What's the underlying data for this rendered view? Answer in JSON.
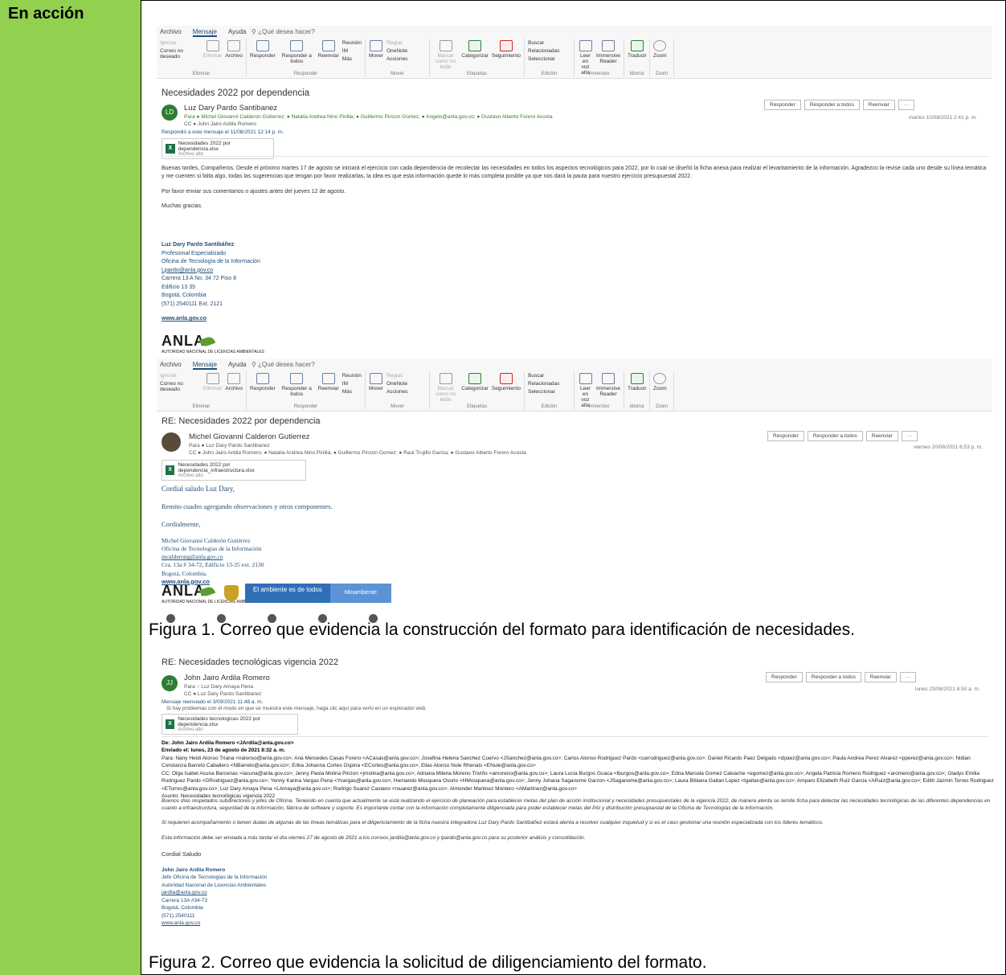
{
  "side_label": "En acción",
  "ribbon": {
    "menu": [
      "Archivo",
      "Mensaje",
      "Ayuda"
    ],
    "tell_me": "¿Qué desea hacer?",
    "groups": [
      {
        "label": "Eliminar",
        "buttons": [
          "Ignorar",
          "Correo no deseado",
          "Eliminar",
          "Archivo"
        ]
      },
      {
        "label": "Responder",
        "buttons": [
          "Responder",
          "Responder a todos",
          "Reenviar",
          "Reunión",
          "IM",
          "Más"
        ]
      },
      {
        "label": "Mover",
        "buttons": [
          "Mover",
          "Reglas",
          "OneNote",
          "Acciones"
        ]
      },
      {
        "label": "Etiquetas",
        "buttons": [
          "Marcar como no leído",
          "Categorizar",
          "Seguimiento"
        ]
      },
      {
        "label": "Edición",
        "buttons": [
          "Buscar",
          "Relacionadas",
          "Seleccionar"
        ]
      },
      {
        "label": "Inmersivo",
        "buttons": [
          "Leer en voz alta",
          "Immersive Reader"
        ]
      },
      {
        "label": "Idioma",
        "buttons": [
          "Traducir"
        ]
      },
      {
        "label": "Zoom",
        "buttons": [
          "Zoom"
        ]
      }
    ]
  },
  "actions": {
    "reply": "Responder",
    "reply_all": "Responder a todos",
    "forward": "Reenviar",
    "more": "···"
  },
  "email1": {
    "subject": "Necesidades 2022 por dependencia",
    "initials": "LD",
    "sender": "Luz Dary Pardo Santibanez",
    "to": "Para  ● Michel Giovanni Calderon Gutierrez; ● Natalia Andrea Nino Pinilla; ● Guillermo Pinzon Gomez; ● Angelo@anla.gov.co; ● Gustavo Alberto Forero Acosta",
    "cc": "CC  ● John Jairo Ardila Romero",
    "info": "Respondió a este mensaje el 11/08/2021 12:14 p. m.",
    "date": "martes 10/08/2021 2:41 p. m.",
    "attachment": "Necesidades 2022 por dependencia.xlsx",
    "attachment_size": "Archivo alto",
    "body": [
      "Buenas tardes, Compañeros. Desde el próximo martes 17 de agosto se iniciará el ejercicio con cada dependencia de recolectar las necesidades en todos los aspectos tecnológicos para 2022, por lo cual se diseñó la ficha anexa para realizar el levantamiento de la información. Agradezco la revise cada uno desde su línea temática y me cuenten si falta algo, todas las sugerencias que tengan por favor realizarlas, la idea es que esta información quede lo más completa posible ya que nos dará la pauta para nuestro ejercicio presupuestal 2022.",
      "Por favor enviar sus comentarios o ajustes antes del jueves 12 de agosto.",
      "Muchas gracias."
    ],
    "signature": {
      "name": "Luz Dary Pardo Santibáñez",
      "lines": [
        "Profesional Especializado",
        "Oficina de Tecnología de la Información",
        "Lpardo@anla.gov.co",
        "Carrera 13 A No. 34 72 Piso 8",
        "Edificio 13 35",
        "Bogotá, Colombia",
        "(571) 2540111 Ext. 2121"
      ],
      "web": "www.anla.gov.co"
    }
  },
  "logo": {
    "text": "ANLA",
    "subtitle": "AUTORIDAD NACIONAL DE LICENCIAS AMBIENTALES"
  },
  "email2": {
    "subject": "RE: Necesidades 2022 por dependencia",
    "sender": "Michel Giovanni Calderon Gutierrez",
    "to": "Para  ● Luz Dary Pardo Santibanez",
    "cc": "CC  ● John Jairo Ardila Romero; ● Natalia Andrea Nino Pinilla; ● Guillermo Pinzon Gomez; ● Raul Trujillo Garcia; ● Gustavo Alberto Forero Acosta",
    "date": "viernes 20/08/2021 6:53 p. m.",
    "attachment": "Necesidades 2022 por dependencia_infraestructura.xlsx",
    "attachment_size": "Archivo alto",
    "greeting": "Cordial saludo Luz Dary,",
    "body": "Remito cuadro agregando observaciones y otros componentes.",
    "closing": "Cordialmente,",
    "signature": [
      "Michel Giovanni Calderón Gutiérrez",
      "Oficina de Tecnologías de la Información",
      "mcalderong@anla.gov.co",
      "Cra. 13a # 34-72, Edificio 13-35 ext. 2130",
      "Bogotá, Colombia.",
      "www.anla.gov.co"
    ],
    "banner": {
      "left": "El ambiente es de todos",
      "right": "Minambiente"
    }
  },
  "caption1": "Figura 1. Correo que evidencia la construcción del formato para identificación de necesidades.",
  "email3": {
    "subject": "RE: Necesidades tecnológicas vigencia 2022",
    "initials": "JJ",
    "sender": "John Jairo Ardila Romero",
    "to": "Para  ○ Luz Dary Amaya Pena",
    "cc": "CC  ● Luz Dary Pardo Santibanez",
    "info1": "Mensaje reenviado el 3/09/2021 11:48 a. m.",
    "info2": "Si hay problemas con el modo en que se muestra este mensaje, haga clic aquí para verlo en un explorador web.",
    "date": "lunes 23/08/2021 8:50 a. m.",
    "attachment": "Necesidades tecnologicas 2022 por dependencia.xlsx",
    "attachment_size": "Archivo alto",
    "header": {
      "from": "De: John Jairo Ardila Romero <JArdila@anla.gov.co>",
      "sent": "Enviado el: lunes, 23 de agosto de 2021 8:32 a. m.",
      "to": "Para: Nany Heidi Alonso Triana <nalonso@anla.gov.co>; Ana Mercedes Casas Forero <ACasas@anla.gov.co>; Josefina Helena Sanchez Cuervo <JSanchez@anla.gov.co>; Carlos Alonso Rodriguez Pardo <carrodriguez@anla.gov.co>; Daniel Ricardo Paez Delgado <dpaez@anla.gov.co>; Paula Andrea Perez Alvarez <pperez@anla.gov.co>; Nidian Constanza Barreto Caballero <NBarreto@anla.gov.co>; Erika Johanna Cortes Ospina <ECortes@anla.gov.co>; Elias Alonso Nule Rhenals <ENule@anla.gov.co>",
      "cc": "CC: Olga Isabel Acuna Barcenas <iacuna@anla.gov.co>; Jenny Paola Molina Pinzon <jmolina@anla.gov.co>; Adriana Milena Moreno Triviño <amoreno@anla.gov.co>; Laura Lucia Burgos Guaca <lburgos@anla.gov.co>; Edna Marcela Gomez Calvache <egomez@anla.gov.co>; Angela Patricia Romero Rodriguez <aromero@anla.gov.co>; Gladys Emilia Rodriguez Pardo <GRodriguez@anla.gov.co>; Yenny Karina Vargas Pena <Yvargas@anla.gov.co>; Hernando Mosquera Osorio <HMosquera@anla.gov.co>; Jenny Johana Saganome Garzon <JSaganome@anla.gov.co>; Laura Bibiana Gaitan Lopez <lgaitan@anla.gov.co>; Amparo Elizabeth Ruiz Garcia <ARuiz@anla.gov.co>; Edith Jazmin Torres Rodriguez <ETorres@anla.gov.co>; Luz Dary Amaya Pena <LAmaya@anla.gov.co>; Rodrigo Suarez Castano <rsuarez@anla.gov.co>; Almonder Martinez Montero <AMartinez@anla.gov.co>",
      "subject": "Asunto: Necesidades tecnológicas vigencia 2022"
    },
    "body": [
      "Buenos días respetados subdirectores y jefes de Oficina. Teniendo en cuenta que actualmente se está realizando el ejercicio de planeación para establecer metas del plan de acción institucional y necesidades presupuestales de la vigencia 2022, de manera atenta se remite ficha para detectar las necesidades tecnológicas de las diferentes dependencias en cuanto a infraestructura, seguridad de la información, fábrica de software y soporte. Es importante contar con la información completamente diligenciada para poder establecer metas del PAI y distribución presupuestal de la Oficina de Tecnologías de la Información.",
      "Si requieren acompañamiento o tienen dudas de algunas de las líneas temáticas para el diligenciamiento de la ficha nuestra integradora Luz Dary Pardo Santibáñez estará atenta a resolver cualquier inquietud y si es el caso gestionar una reunión especializada con los líderes temáticos.",
      "Esta información debe ser enviada a más tardar el día viernes 27 de agosto de 2021 a los correos jardila@anla.gov.co y lpardo@anla.gov.co para su posterior análisis y consolidación."
    ],
    "closing": "Cordial Saludo",
    "signature": [
      "John Jairo Ardila Romero",
      "Jefe Oficina de Tecnologías de la Información",
      "Autoridad Nacional de Licencias Ambientales",
      "jardila@anla.gov.co",
      "Carrera 13A #34-72",
      "Bogotá, Colombia",
      "(571) 2540111",
      "www.anla.gov.co"
    ]
  },
  "caption2": "Figura 2. Correo que evidencia la solicitud de diligenciamiento del formato."
}
